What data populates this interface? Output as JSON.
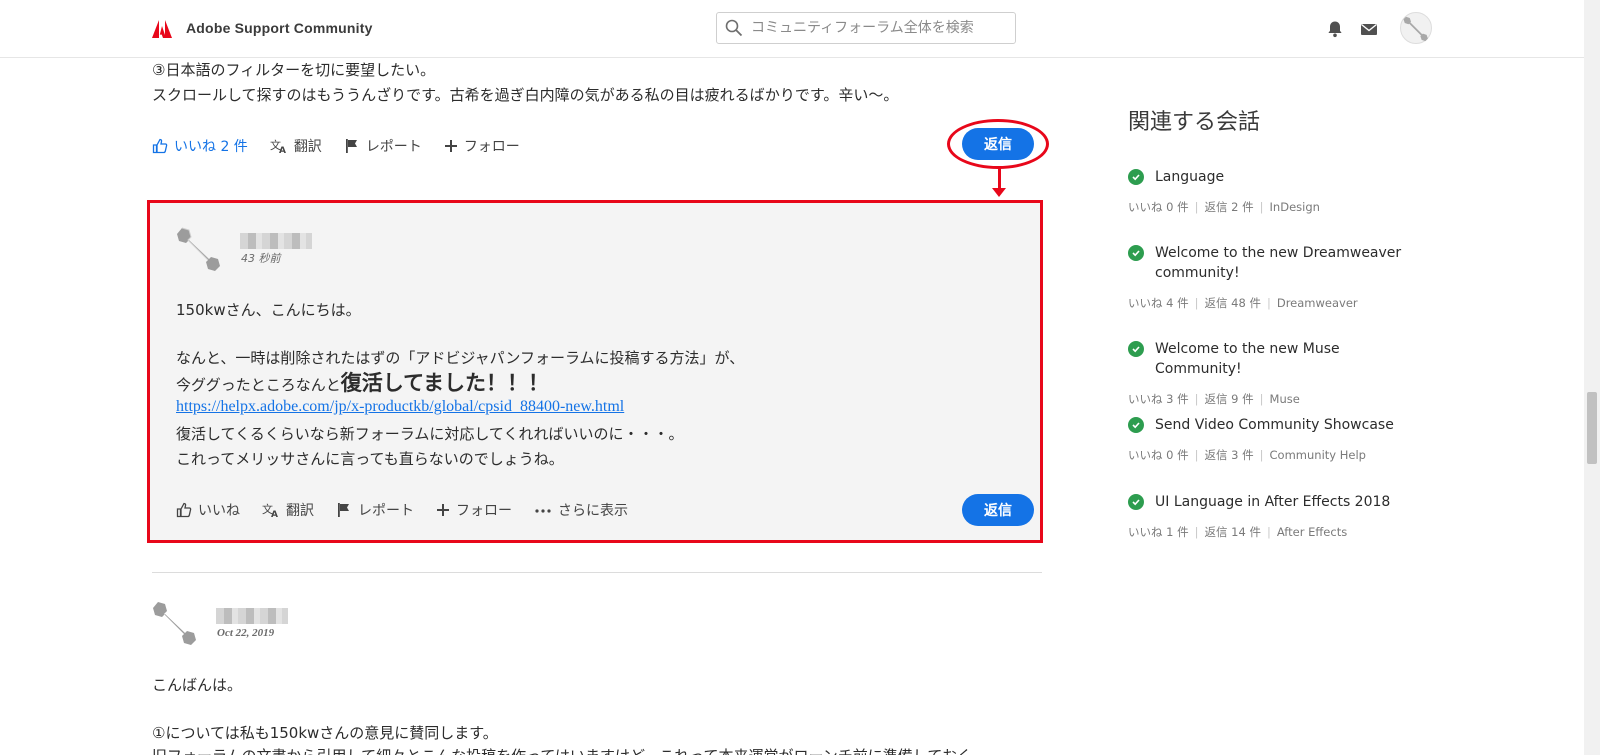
{
  "header": {
    "brand": "Adobe Support Community",
    "search_placeholder": "コミュニティフォーラム全体を検索"
  },
  "post": {
    "line1": "③日本語のフィルターを切に要望したい。",
    "line2": "スクロールして探すのはもううんざりです。古希を過ぎ白内障の気がある私の目は疲れるばかりです。辛い〜。",
    "actions": {
      "like": "いいね 2 件",
      "translate": "翻訳",
      "report": "レポート",
      "follow": "フォロー"
    },
    "reply": "返信"
  },
  "reply_card": {
    "time": "43 秒前",
    "greeting": "150kwさん、こんにちは。",
    "para1": "なんと、一時は削除されたはずの「アドビジャパンフォーラムに投稿する方法」が、",
    "para2_prefix": "今ググったところなんと",
    "para2_bold": "復活してました！！！",
    "link": "https://helpx.adobe.com/jp/x-productkb/global/cpsid_88400-new.html",
    "para3": "復活してくるくらいなら新フォーラムに対応してくれればいいのに・・・。",
    "para4": "これってメリッサさんに言っても直らないのでしょうね。",
    "actions": {
      "like": "いいね",
      "translate": "翻訳",
      "report": "レポート",
      "follow": "フォロー",
      "more": "さらに表示"
    },
    "reply": "返信"
  },
  "next_post": {
    "date": "Oct 22, 2019",
    "line1": "こんばんは。",
    "line2": "①については私も150kwさんの意見に賛同します。",
    "line3": "旧フォーラムの文書から引用して細々とこんな投稿を作ってはいますけど、これって本来運営がローンチ前に準備しておく"
  },
  "sidebar": {
    "title": "関連する会話",
    "conversations": [
      {
        "title": "Language",
        "likes": "いいね 0 件",
        "replies": "返信 2 件",
        "board": "InDesign"
      },
      {
        "title": "Welcome to the new Dreamweaver community!",
        "likes": "いいね 4 件",
        "replies": "返信 48 件",
        "board": "Dreamweaver"
      },
      {
        "title": "Welcome to the new Muse Community!",
        "likes": "いいね 3 件",
        "replies": "返信 9 件",
        "board": "Muse"
      },
      {
        "title": "Send Video Community Showcase",
        "likes": "いいね 0 件",
        "replies": "返信 3 件",
        "board": "Community Help"
      },
      {
        "title": "UI Language in After Effects 2018",
        "likes": "いいね 1 件",
        "replies": "返信 14 件",
        "board": "After Effects"
      }
    ]
  },
  "colors": {
    "accent": "#1473e6",
    "highlight": "#e8071a",
    "check": "#2d9d4f"
  }
}
